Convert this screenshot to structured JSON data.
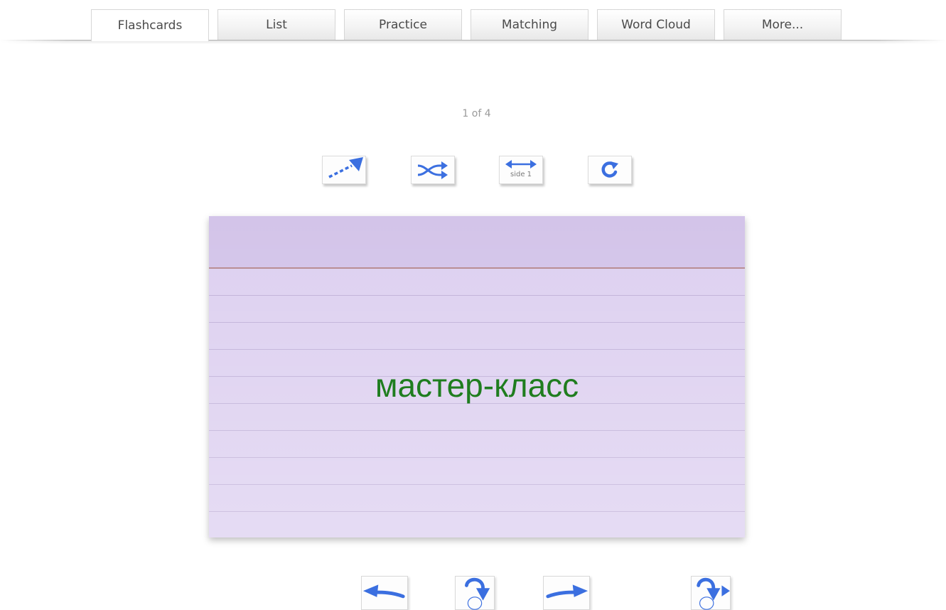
{
  "tabs": [
    {
      "label": "Flashcards",
      "active": true
    },
    {
      "label": "List",
      "active": false
    },
    {
      "label": "Practice",
      "active": false
    },
    {
      "label": "Matching",
      "active": false
    },
    {
      "label": "Word Cloud",
      "active": false
    },
    {
      "label": "More...",
      "active": false
    }
  ],
  "counter": {
    "text": "1 of 4"
  },
  "toolbar": {
    "buttons": [
      {
        "icon": "auto-play-arrow-icon"
      },
      {
        "icon": "shuffle-icon"
      },
      {
        "icon": "switch-side-icon",
        "label": "side 1"
      },
      {
        "icon": "restart-icon"
      }
    ]
  },
  "card": {
    "text": "мастер-класс",
    "text_color": "#1f7d1f",
    "background_color": "#ddd0f0"
  },
  "nav": {
    "buttons": [
      {
        "icon": "previous-arrow-icon"
      },
      {
        "icon": "flip-card-icon"
      },
      {
        "icon": "next-arrow-icon"
      },
      {
        "icon": "flip-and-next-icon"
      }
    ]
  },
  "colors": {
    "accent": "#3b6fe0",
    "tab_text": "#4a4a4a",
    "counter_text": "#9a9a9a"
  }
}
